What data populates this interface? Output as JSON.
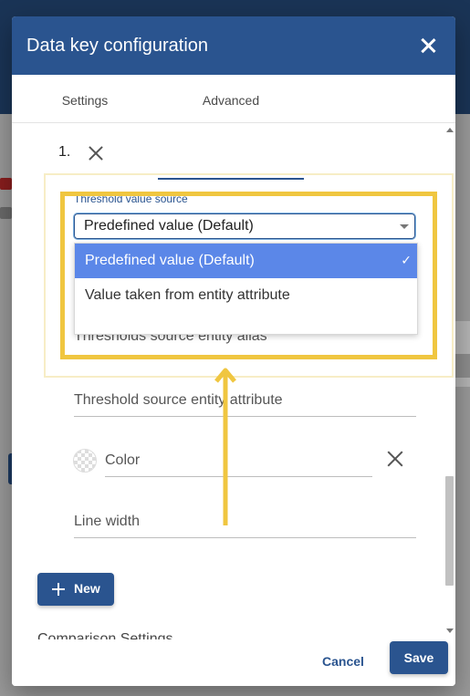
{
  "dialog": {
    "title": "Data key configuration"
  },
  "tabs": [
    {
      "label": "Settings"
    },
    {
      "label": "Advanced"
    }
  ],
  "threshold": {
    "index": "1.",
    "source_label": "Threshold value source",
    "source_value": "Predefined value (Default)",
    "options": [
      {
        "label": "Predefined value (Default)",
        "selected": true
      },
      {
        "label": "Value taken from entity attribute",
        "selected": false
      }
    ],
    "check_mark": "✓",
    "entity_alias_label": "Thresholds source entity alias",
    "entity_attribute_label": "Threshold source entity attribute",
    "color_label": "Color",
    "line_width_label": "Line width"
  },
  "new_button": {
    "label": "New"
  },
  "comparison_heading": "Comparison Settings",
  "actions": {
    "cancel_label": "Cancel",
    "save_label": "Save"
  },
  "colors": {
    "primary": "#2a548f",
    "selected_option": "#5b87e8",
    "highlight": "#f0c640"
  },
  "icons": [
    "close-icon",
    "remove-icon",
    "chevron-down-icon",
    "check-icon",
    "color-swatch",
    "plus-icon",
    "arrow-up-icon"
  ]
}
